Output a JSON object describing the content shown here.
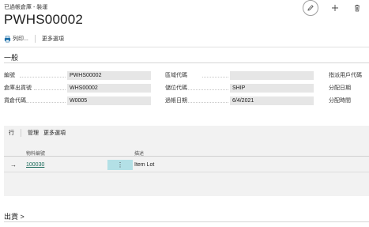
{
  "header": {
    "breadcrumb": "已過帳倉庫 - 裝運",
    "title": "PWHS00002"
  },
  "actions": {
    "print_label": "列印...",
    "more_label": "更多選項"
  },
  "general": {
    "section_title": "一般",
    "fields": {
      "no_label": "編號",
      "no_value": "PWHS00002",
      "shipment_no_label": "倉庫出貨號",
      "shipment_no_value": "WHS00002",
      "location_label": "貨倉代碼",
      "location_value": "W0005",
      "zone_label": "區域代碼",
      "zone_value": "",
      "bin_label": "儲位代碼",
      "bin_value": "SHIP",
      "posting_date_label": "過帳日期",
      "posting_date_value": "6/4/2021",
      "assigned_user_label": "指派用戶代碼",
      "assignment_date_label": "分配日期",
      "assignment_time_label": "分配時間"
    }
  },
  "lines": {
    "toolbar": {
      "lines_label": "行",
      "manage_label": "管理",
      "more_label": "更多選項"
    },
    "columns": {
      "item_no": "物料編號",
      "description": "描述"
    },
    "rows": [
      {
        "item_no": "100030",
        "menu": "⋮",
        "description": "Item Lot"
      }
    ]
  },
  "shipping": {
    "section_title": "出貨 >"
  }
}
